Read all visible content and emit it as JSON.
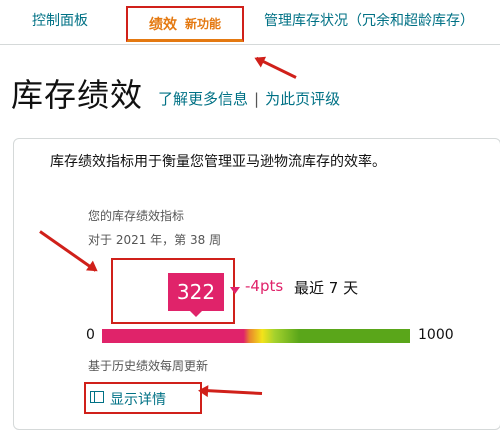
{
  "tabs": [
    {
      "label": "控制面板"
    },
    {
      "label": "绩效",
      "badge": "新功能",
      "active": true
    },
    {
      "label": "管理库存状况（冗余和超龄库存）"
    }
  ],
  "page": {
    "title": "库存绩效",
    "learn_more": "了解更多信息",
    "separator": "|",
    "rate_page": "为此页评级"
  },
  "card": {
    "description": "库存绩效指标用于衡量您管理亚马逊物流库存的效率。",
    "metric_title": "您的库存绩效指标",
    "week": "对于 2021 年，第 38 周",
    "score": "322",
    "change": "-4pts",
    "recent": "最近 7 天",
    "scale_min": "0",
    "scale_max": "1000",
    "basis_note": "基于历史绩效每周更新",
    "details_label": "显示详情"
  },
  "colors": {
    "accent": "#e47911",
    "link": "#007185",
    "score": "#e0236a",
    "annotation": "#d0201a",
    "good": "#5aa61a"
  }
}
